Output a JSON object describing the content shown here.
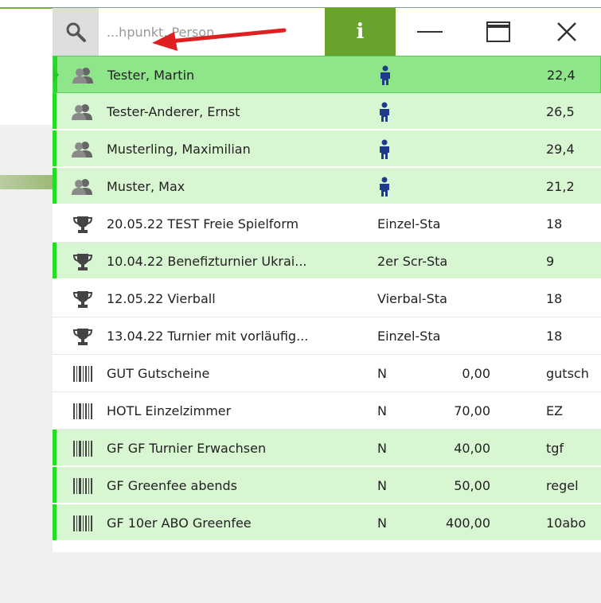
{
  "search": {
    "placeholder": "...hpunkt, Person,"
  },
  "toolbar": {
    "info_label": "i"
  },
  "colors": {
    "accent": "#6aa22e",
    "row_highlight": "#d9f6d2",
    "row_selected": "#8ee58a",
    "marker": "#22dd22",
    "gender_icon": "#1e3a8a"
  },
  "rows": [
    {
      "type": "person",
      "icon": "people-icon",
      "name": "Tester, Martin",
      "col4": "22,4"
    },
    {
      "type": "person",
      "icon": "people-icon",
      "name": "Tester-Anderer, Ernst",
      "col4": "26,5"
    },
    {
      "type": "person",
      "icon": "people-icon",
      "name": "Musterling, Maximilian",
      "col4": "29,4"
    },
    {
      "type": "person",
      "icon": "people-icon",
      "name": "Muster, Max",
      "col4": "21,2"
    },
    {
      "type": "tournament",
      "icon": "trophy-icon",
      "name": "20.05.22 TEST Freie Spielform",
      "col2": "Einzel-Sta",
      "col4": "18"
    },
    {
      "type": "tournament",
      "icon": "trophy-icon",
      "name": "10.04.22 Benefizturnier Ukrai...",
      "col2": "2er Scr-Sta",
      "col4": "9"
    },
    {
      "type": "tournament",
      "icon": "trophy-icon",
      "name": "12.05.22 Vierball",
      "col2": "Vierbal-Sta",
      "col4": "18"
    },
    {
      "type": "tournament",
      "icon": "trophy-icon",
      "name": "13.04.22 Turnier mit vorläufig...",
      "col2": "Einzel-Sta",
      "col4": "18"
    },
    {
      "type": "article",
      "icon": "barcode-icon",
      "name": "GUT Gutscheine",
      "col2": "N",
      "col3": "0,00",
      "col4": "gutsch"
    },
    {
      "type": "article",
      "icon": "barcode-icon",
      "name": "HOTL Einzelzimmer",
      "col2": "N",
      "col3": "70,00",
      "col4": "EZ"
    },
    {
      "type": "article",
      "icon": "barcode-icon",
      "name": "GF GF Turnier Erwachsen",
      "col2": "N",
      "col3": "40,00",
      "col4": "tgf"
    },
    {
      "type": "article",
      "icon": "barcode-icon",
      "name": "GF Greenfee abends",
      "col2": "N",
      "col3": "50,00",
      "col4": "regel"
    },
    {
      "type": "article",
      "icon": "barcode-icon",
      "name": "GF 10er ABO Greenfee",
      "col2": "N",
      "col3": "400,00",
      "col4": "10abo"
    }
  ]
}
